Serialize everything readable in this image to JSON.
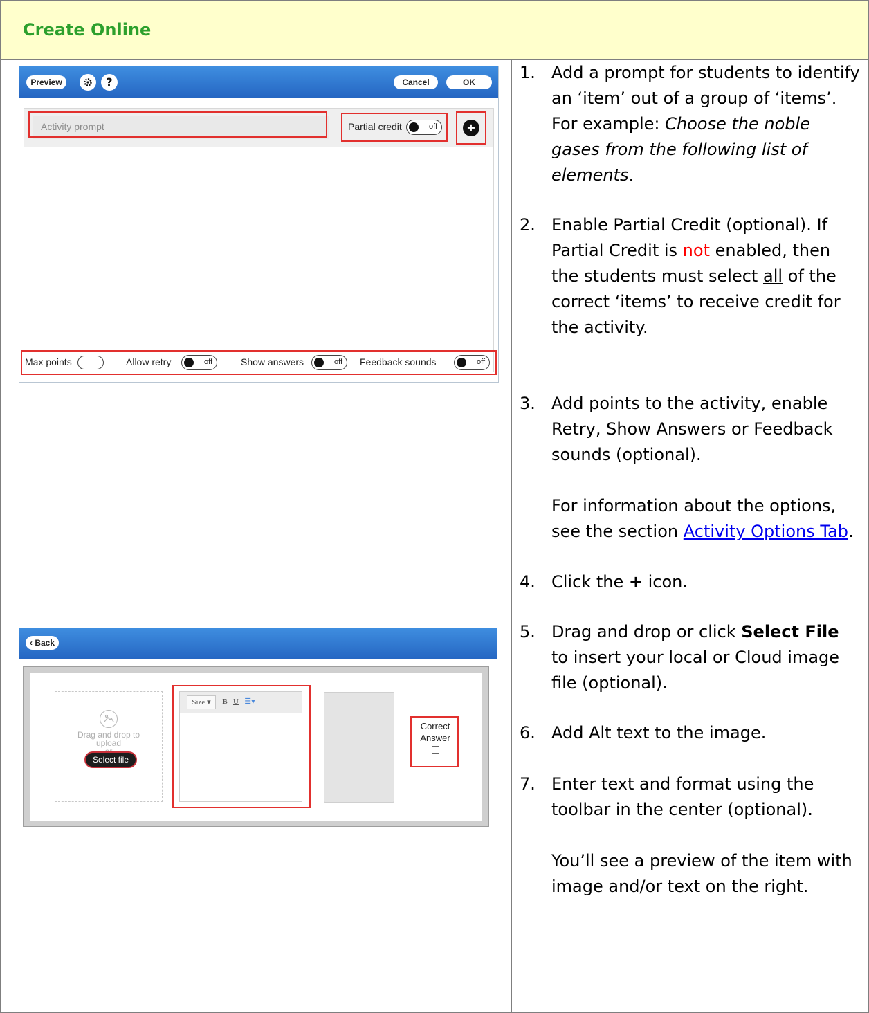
{
  "header": {
    "title": "Create Online"
  },
  "shot1": {
    "preview_label": "Preview",
    "help_label": "?",
    "cancel_label": "Cancel",
    "ok_label": "OK",
    "prompt_placeholder": "Activity prompt",
    "partial_credit_label": "Partial credit",
    "toggle_off": "off",
    "plus_label": "+",
    "max_points_label": "Max points",
    "allow_retry_label": "Allow retry",
    "show_answers_label": "Show answers",
    "feedback_sounds_label": "Feedback sounds"
  },
  "shot2": {
    "back_label": "Back",
    "drag_drop_line1": "Drag and drop to",
    "drag_drop_line2": "upload",
    "or_label": "or",
    "select_file_label": "Select file",
    "size_label": "Size",
    "bold_label": "B",
    "underline_label": "U",
    "correct_line1": "Correct",
    "correct_line2": "Answer"
  },
  "steps": {
    "s1": {
      "num": "1.",
      "text": "Add a prompt for students to identify an ‘item’ out of a group of ‘items’. For example:",
      "example": "Choose the noble gases from the following list of elements",
      "end": "."
    },
    "s2": {
      "num": "2.",
      "a": "Enable Partial Credit (optional). If Partial Credit is",
      "not": "not",
      "b": "enabled, then the students must select",
      "all": "all",
      "c": "of the correct ‘items’ to receive credit for the activity."
    },
    "s3": {
      "num": "3.",
      "text": "Add points to the activity, enable Retry, Show Answers or Feedback sounds (optional).",
      "info": "For information about the options, see the section",
      "link": "Activity Options Tab",
      "end": "."
    },
    "s4": {
      "num": "4.",
      "a": "Click the",
      "plus": "+",
      "b": "icon."
    },
    "s5": {
      "num": "5.",
      "a": "Drag and drop or click",
      "bold": "Select File",
      "b": "to insert your local or Cloud image file (optional)."
    },
    "s6": {
      "num": "6.",
      "text": "Add Alt text to the image."
    },
    "s7": {
      "num": "7.",
      "text": "Enter text and format using the toolbar in the center (optional).",
      "note": "You’ll see a preview of the item with image and/or text on the right."
    }
  }
}
